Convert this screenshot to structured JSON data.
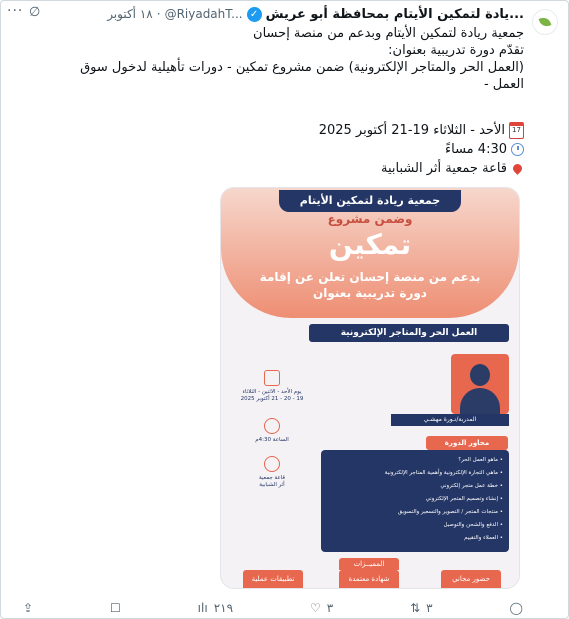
{
  "tweet": {
    "author_name": "...يادة لتمكين الأيتام بمحافظة أبو عريش",
    "handle": "@RiyadahT...",
    "time": "١٨ أكتوبر",
    "more_label": "···",
    "grok_label": "∅",
    "lines": [
      "جمعية ريادة لتمكين الأيتام وبدعم من منصة إحسان",
      "تقدّم دورة تدريبية بعنوان:",
      "(العمل الحر والمتاجر الإلكترونية) ضمن مشروع تمكين - دورات تأهيلية لدخول سوق",
      "العمل -"
    ],
    "date_line": "الأحد - الثلاثاء 19-21 أكتوبر 2025",
    "time_line": "4:30 مساءً",
    "place_line": "قاعة جمعية أثر الشبابية",
    "calendar_icon_text": "17"
  },
  "poster": {
    "banner": "جمعية ريادة لتمكين الأيتام",
    "within_project": "وضمن مشروع",
    "project": "تمكين",
    "line1": "بدعم من منصة إحسان تعلن عن إقامة",
    "line2": "دورة تدريبية بعنوان",
    "course_title": "العمل الحر والمتاجر الإلكترونية",
    "trainer": "المدربة/نـورة مهشـي",
    "days": "يوم الأحد - الاثنين - الثلاثاء",
    "dates": "19 - 20 - 21 أكتوبر 2025",
    "time": "الساعة 4:30م",
    "place1": "قاعة جمعية",
    "place2": "أثر الشبابية",
    "axes_title": "محاور الدورة",
    "axes": [
      "ماهو العمل الحر؟",
      "ماهي التجارة الإلكترونية وأهمية المتاجر الإلكترونية",
      "خطة عمل متجر إلكتروني",
      "إنشاء وتصميم المتجر الإلكتروني",
      "منتجات المتجر / التصوير والتسعير والتسويق",
      "الدفع والشحن والتوصيل",
      "العملاء والتقييم"
    ],
    "features_title": "المميــزات",
    "features": [
      "حضور مجاني",
      "شهادة معتمدة",
      "تطبيقات عملية"
    ]
  },
  "actions": {
    "reply_count": "",
    "repost_count": "٣",
    "like_count": "٣",
    "views_count": "٢١٩"
  }
}
